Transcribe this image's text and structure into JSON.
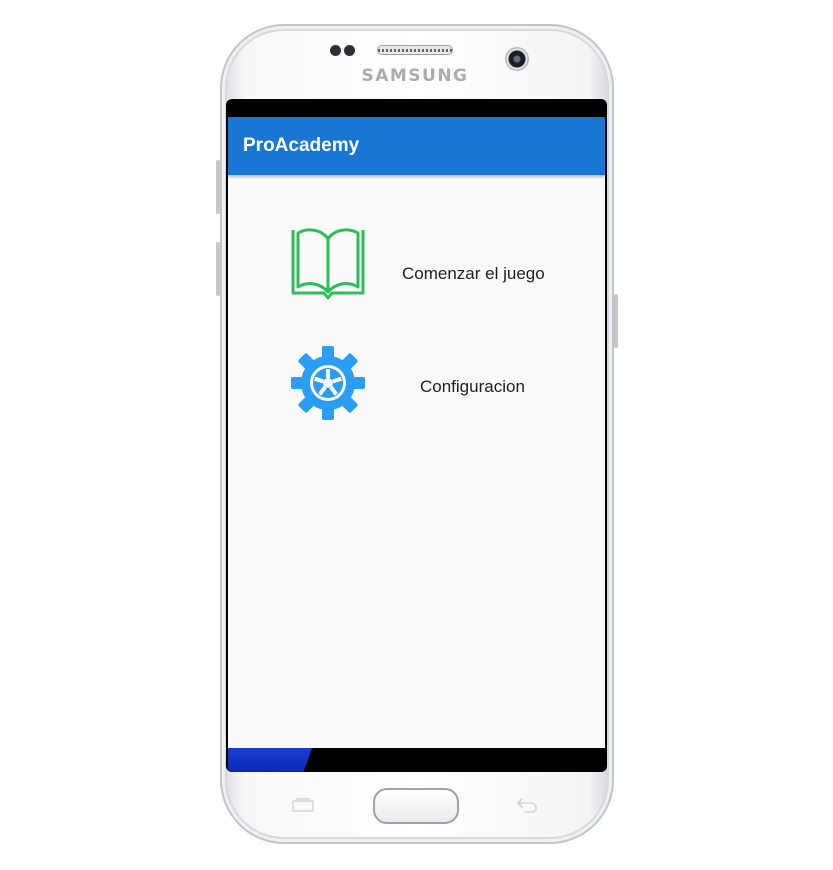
{
  "device": {
    "brand": "SAMSUNG"
  },
  "appbar": {
    "title": "ProAcademy",
    "color": "#1976d2"
  },
  "menu": [
    {
      "label": "Comenzar el juego",
      "icon": "book-icon",
      "icon_color": "#2ebd59"
    },
    {
      "label": "Configuracion",
      "icon": "gear-icon",
      "icon_color": "#2a9df4"
    }
  ]
}
